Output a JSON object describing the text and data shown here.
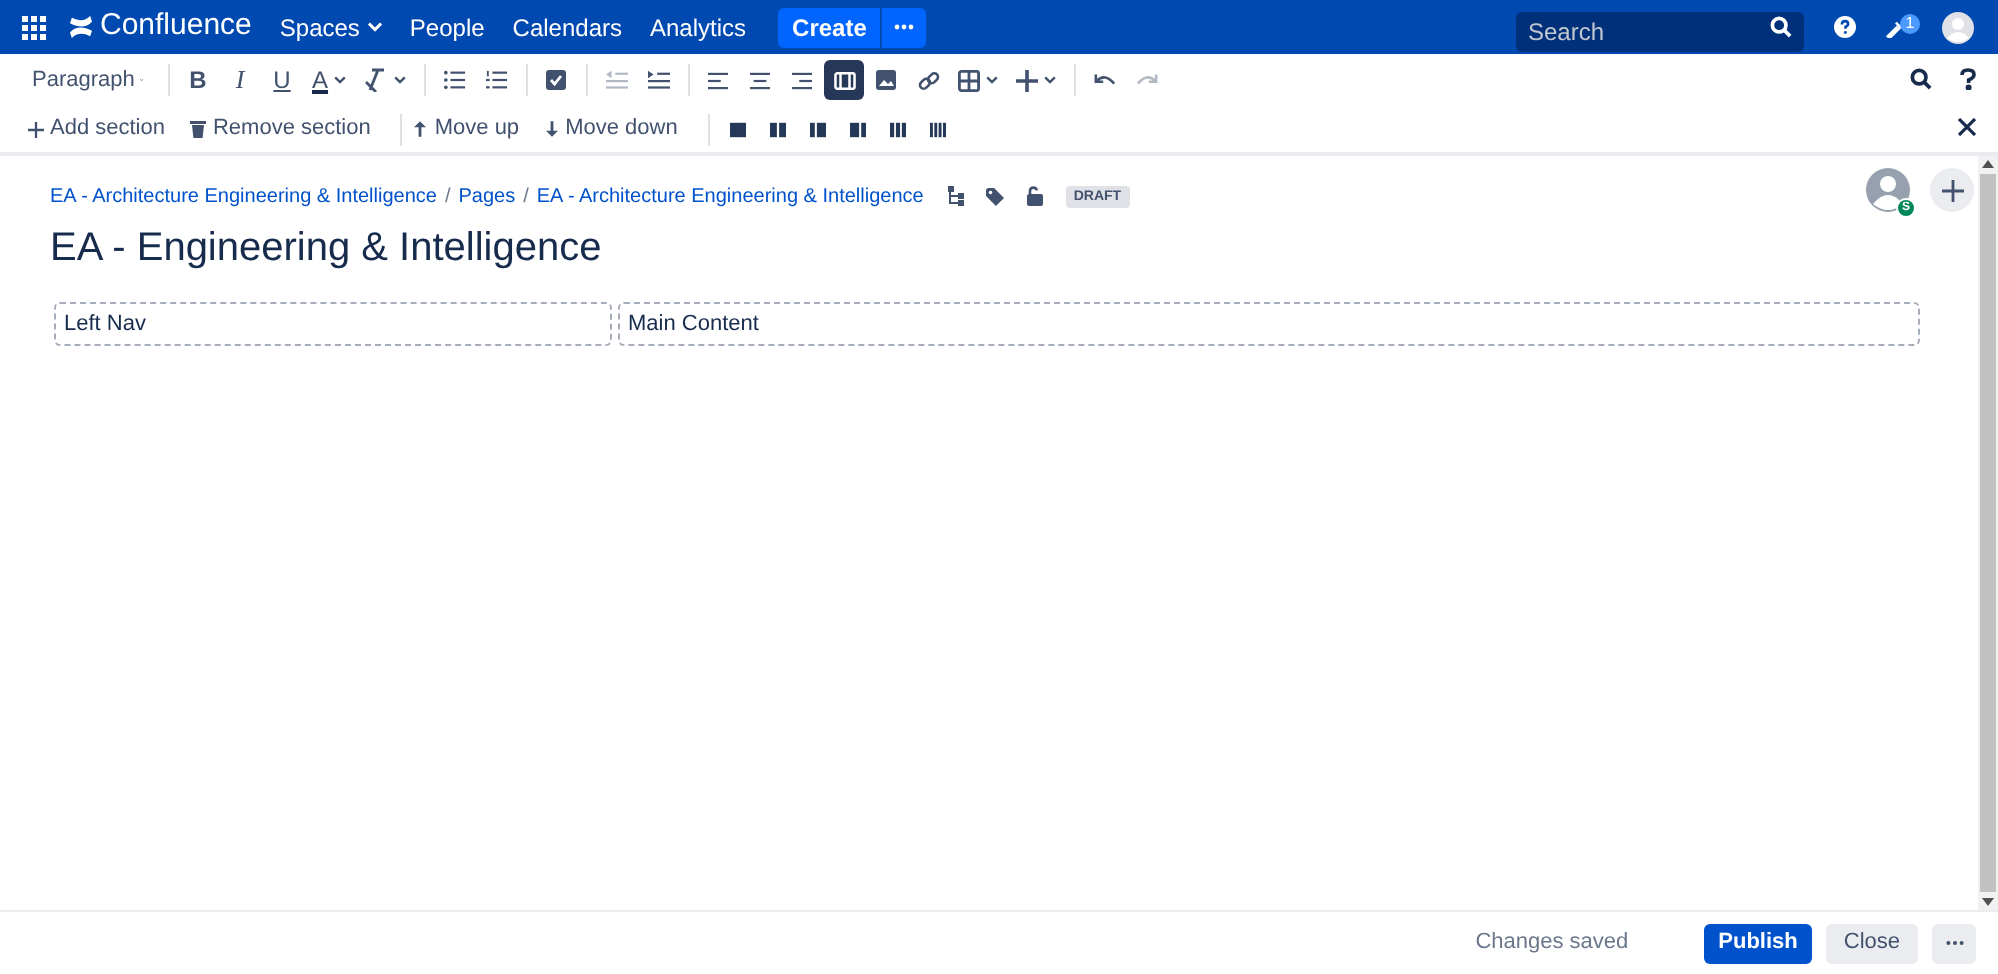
{
  "header": {
    "logo": "Confluence",
    "nav": [
      {
        "label": "Spaces",
        "dropdown": true
      },
      {
        "label": "People",
        "dropdown": false
      },
      {
        "label": "Calendars",
        "dropdown": false
      },
      {
        "label": "Analytics",
        "dropdown": false
      }
    ],
    "create": "Create",
    "search": {
      "placeholder": "Search"
    },
    "notification_count": "1"
  },
  "toolbar": [
    {
      "kind": "style",
      "label": "Paragraph",
      "dropdown": true,
      "selected": false,
      "disabled": false
    },
    {
      "kind": "sep"
    },
    {
      "kind": "bold",
      "label": "B",
      "dropdown": false,
      "selected": false,
      "disabled": false
    },
    {
      "kind": "italic",
      "label": "I",
      "dropdown": false,
      "selected": false,
      "disabled": false
    },
    {
      "kind": "underline",
      "label": "U",
      "dropdown": false,
      "selected": false,
      "disabled": false
    },
    {
      "kind": "color",
      "label": "A",
      "dropdown": true,
      "selected": false,
      "disabled": false
    },
    {
      "kind": "clear",
      "dropdown": true,
      "selected": false,
      "disabled": false
    },
    {
      "kind": "sep"
    },
    {
      "kind": "bullets",
      "dropdown": false,
      "selected": false,
      "disabled": false
    },
    {
      "kind": "numbers",
      "dropdown": false,
      "selected": false,
      "disabled": false
    },
    {
      "kind": "sep"
    },
    {
      "kind": "task",
      "dropdown": false,
      "selected": false,
      "disabled": false
    },
    {
      "kind": "sep"
    },
    {
      "kind": "outdent",
      "dropdown": false,
      "selected": false,
      "disabled": true
    },
    {
      "kind": "indent",
      "dropdown": false,
      "selected": false,
      "disabled": false
    },
    {
      "kind": "sep"
    },
    {
      "kind": "align-left",
      "dropdown": false,
      "selected": false,
      "disabled": false
    },
    {
      "kind": "align-center",
      "dropdown": false,
      "selected": false,
      "disabled": false
    },
    {
      "kind": "align-right",
      "dropdown": false,
      "selected": false,
      "disabled": false
    },
    {
      "kind": "layout",
      "dropdown": false,
      "selected": true,
      "disabled": false
    },
    {
      "kind": "image",
      "dropdown": false,
      "selected": false,
      "disabled": false
    },
    {
      "kind": "link",
      "dropdown": false,
      "selected": false,
      "disabled": false
    },
    {
      "kind": "table",
      "dropdown": true,
      "selected": false,
      "disabled": false
    },
    {
      "kind": "insert",
      "dropdown": true,
      "selected": false,
      "disabled": false
    },
    {
      "kind": "sep"
    },
    {
      "kind": "undo",
      "dropdown": false,
      "selected": false,
      "disabled": false
    },
    {
      "kind": "redo",
      "dropdown": false,
      "selected": false,
      "disabled": true
    }
  ],
  "section_toolbar": [
    {
      "kind": "add",
      "label": "Add section"
    },
    {
      "kind": "remove",
      "label": "Remove section"
    },
    {
      "kind": "sep"
    },
    {
      "kind": "up",
      "label": "Move up"
    },
    {
      "kind": "down",
      "label": "Move down"
    },
    {
      "kind": "sep"
    },
    {
      "kind": "l1"
    },
    {
      "kind": "l2"
    },
    {
      "kind": "l3"
    },
    {
      "kind": "l4"
    },
    {
      "kind": "l5"
    },
    {
      "kind": "l6"
    }
  ],
  "breadcrumbs": [
    {
      "label": "EA - Architecture Engineering & Intelligence"
    },
    {
      "separator": "/",
      "label": "Pages"
    },
    {
      "separator": "/",
      "label": "EA - Architecture Engineering & Intelligence"
    }
  ],
  "status_badge": "DRAFT",
  "collaborator_badge": "S",
  "title": "EA - Engineering & Intelligence",
  "columns": [
    {
      "text": "Left Nav"
    },
    {
      "text": "Main Content"
    }
  ],
  "footer": {
    "status": "Changes saved",
    "publish": "Publish",
    "close": "Close"
  }
}
